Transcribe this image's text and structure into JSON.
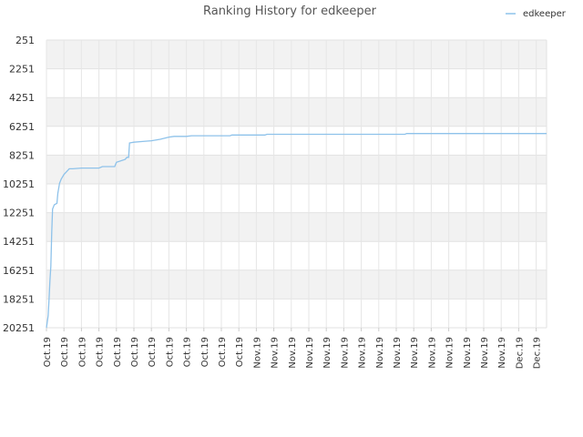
{
  "chart_data": {
    "type": "line",
    "title": "Ranking History for edkeeper",
    "xlabel": "",
    "ylabel": "",
    "y_inverted": true,
    "ylim": [
      251,
      20251
    ],
    "yticks": [
      251,
      2251,
      4251,
      6251,
      8251,
      10251,
      12251,
      14251,
      16251,
      18251,
      20251
    ],
    "xticks": [
      "Oct.19",
      "Oct.19",
      "Oct.19",
      "Oct.19",
      "Oct.19",
      "Oct.19",
      "Oct.19",
      "Oct.19",
      "Oct.19",
      "Oct.19",
      "Oct.19",
      "Oct.19",
      "Nov.19",
      "Nov.19",
      "Nov.19",
      "Nov.19",
      "Nov.19",
      "Nov.19",
      "Nov.19",
      "Nov.19",
      "Nov.19",
      "Nov.19",
      "Nov.19",
      "Nov.19",
      "Nov.19",
      "Nov.19",
      "Nov.19",
      "Dec.19",
      "Dec.19"
    ],
    "x_range": [
      0,
      28.6
    ],
    "grid": true,
    "legend_position": "top-right",
    "series": [
      {
        "name": "edkeeper",
        "color": "#8ec2ea",
        "points": [
          [
            0.0,
            20251
          ],
          [
            0.1,
            19400
          ],
          [
            0.15,
            18200
          ],
          [
            0.2,
            17000
          ],
          [
            0.25,
            16000
          ],
          [
            0.3,
            13600
          ],
          [
            0.35,
            12000
          ],
          [
            0.45,
            11700
          ],
          [
            0.6,
            11600
          ],
          [
            0.65,
            10900
          ],
          [
            0.75,
            10200
          ],
          [
            0.85,
            9900
          ],
          [
            1.0,
            9600
          ],
          [
            1.15,
            9400
          ],
          [
            1.3,
            9200
          ],
          [
            1.5,
            9200
          ],
          [
            2.0,
            9150
          ],
          [
            3.0,
            9150
          ],
          [
            3.2,
            9050
          ],
          [
            3.9,
            9050
          ],
          [
            4.0,
            8750
          ],
          [
            4.5,
            8550
          ],
          [
            4.6,
            8400
          ],
          [
            4.7,
            8400
          ],
          [
            4.75,
            7400
          ],
          [
            5.0,
            7350
          ],
          [
            5.5,
            7300
          ],
          [
            6.0,
            7250
          ],
          [
            6.5,
            7150
          ],
          [
            7.0,
            7000
          ],
          [
            7.3,
            6950
          ],
          [
            8.0,
            6950
          ],
          [
            8.3,
            6900
          ],
          [
            10.5,
            6900
          ],
          [
            10.6,
            6850
          ],
          [
            12.5,
            6850
          ],
          [
            12.6,
            6800
          ],
          [
            20.5,
            6800
          ],
          [
            20.6,
            6750
          ],
          [
            28.6,
            6750
          ]
        ]
      }
    ]
  }
}
